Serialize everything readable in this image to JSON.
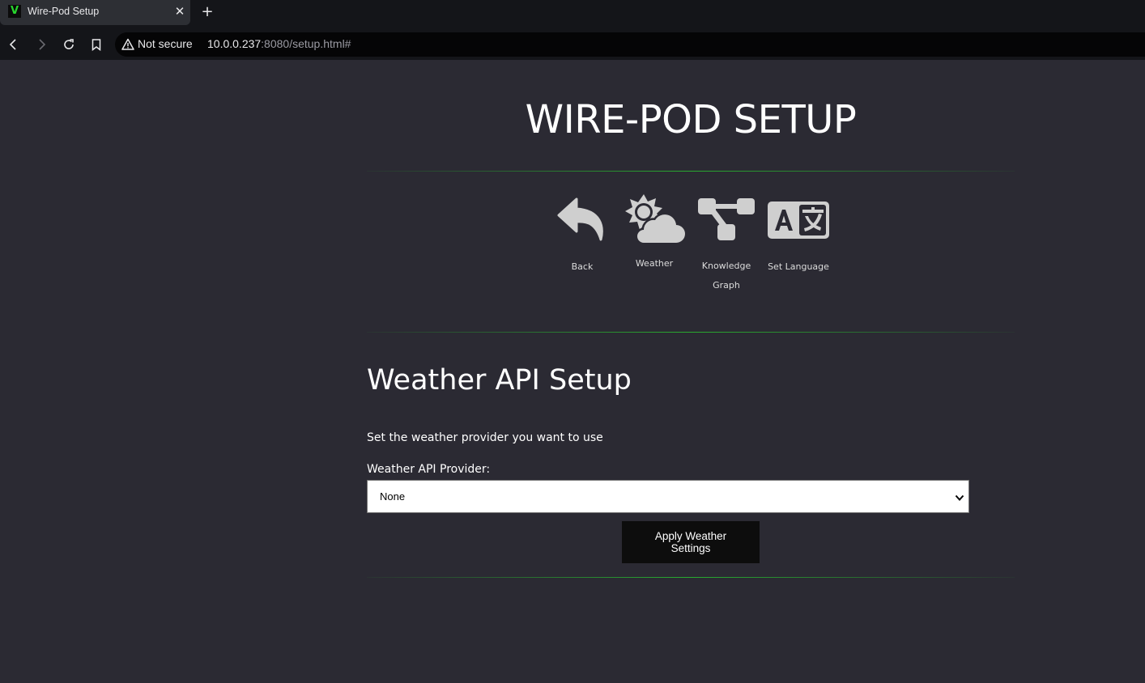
{
  "browser": {
    "tab_title": "Wire-Pod Setup",
    "favicon_letter": "V",
    "tab_close": "✕",
    "new_tab": "+",
    "security_label": "Not secure",
    "url_host": "10.0.0.237",
    "url_rest": ":8080/setup.html#"
  },
  "page": {
    "title": "WIRE-POD SETUP"
  },
  "nav": {
    "items": [
      {
        "label": "Back",
        "icon": "back-arrow-icon"
      },
      {
        "label": "Weather",
        "icon": "weather-icon"
      },
      {
        "label": "Knowledge Graph",
        "icon": "knowledge-graph-icon"
      },
      {
        "label": "Set Language",
        "icon": "language-icon"
      }
    ]
  },
  "weather": {
    "section_title": "Weather API Setup",
    "description": "Set the weather provider you want to use",
    "provider_label": "Weather API Provider:",
    "provider_selected": "None",
    "apply_label": "Apply Weather Settings"
  },
  "colors": {
    "background": "#2b2a33",
    "accent": "#28d62e",
    "icon_gray": "#cfcfcf"
  }
}
